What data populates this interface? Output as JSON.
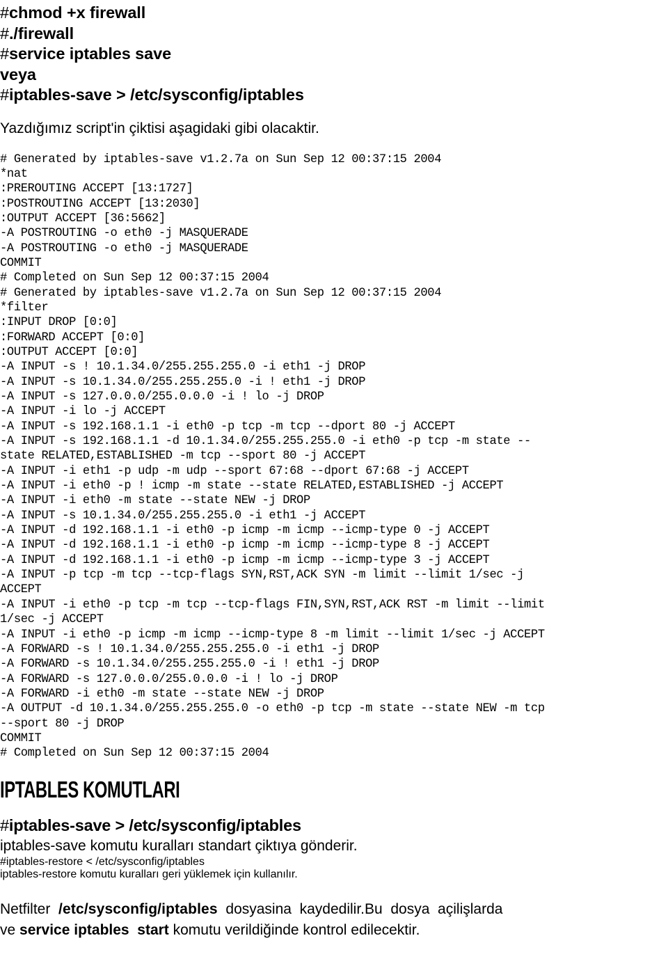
{
  "top_commands": [
    {
      "hash": "#",
      "text": "chmod +x firewall"
    },
    {
      "hash": "#",
      "text": "./firewall"
    },
    {
      "hash": "#",
      "text": "service iptables save"
    },
    {
      "hash": "",
      "text": "veya"
    },
    {
      "hash": "#",
      "text": "iptables-save > /etc/sysconfig/iptables"
    }
  ],
  "intro": "Yazdığımız script'in çiktisi aşagidaki gibi olacaktir.",
  "code_lines": [
    "# Generated by iptables-save v1.2.7a on Sun Sep 12 00:37:15 2004",
    "*nat",
    ":PREROUTING ACCEPT [13:1727]",
    ":POSTROUTING ACCEPT [13:2030]",
    ":OUTPUT ACCEPT [36:5662]",
    "-A POSTROUTING -o eth0 -j MASQUERADE",
    "-A POSTROUTING -o eth0 -j MASQUERADE",
    "COMMIT",
    "# Completed on Sun Sep 12 00:37:15 2004",
    "# Generated by iptables-save v1.2.7a on Sun Sep 12 00:37:15 2004",
    "*filter",
    ":INPUT DROP [0:0]",
    ":FORWARD ACCEPT [0:0]",
    ":OUTPUT ACCEPT [0:0]",
    "-A INPUT -s ! 10.1.34.0/255.255.255.0 -i eth1 -j DROP",
    "-A INPUT -s 10.1.34.0/255.255.255.0 -i ! eth1 -j DROP",
    "-A INPUT -s 127.0.0.0/255.0.0.0 -i ! lo -j DROP",
    "-A INPUT -i lo -j ACCEPT",
    "-A INPUT -s 192.168.1.1 -i eth0 -p tcp -m tcp --dport 80 -j ACCEPT",
    "-A INPUT -s 192.168.1.1 -d 10.1.34.0/255.255.255.0 -i eth0 -p tcp -m state --",
    "state RELATED,ESTABLISHED -m tcp --sport 80 -j ACCEPT",
    "-A INPUT -i eth1 -p udp -m udp --sport 67:68 --dport 67:68 -j ACCEPT",
    "-A INPUT -i eth0 -p ! icmp -m state --state RELATED,ESTABLISHED -j ACCEPT",
    "-A INPUT -i eth0 -m state --state NEW -j DROP",
    "-A INPUT -s 10.1.34.0/255.255.255.0 -i eth1 -j ACCEPT",
    "-A INPUT -d 192.168.1.1 -i eth0 -p icmp -m icmp --icmp-type 0 -j ACCEPT",
    "-A INPUT -d 192.168.1.1 -i eth0 -p icmp -m icmp --icmp-type 8 -j ACCEPT",
    "-A INPUT -d 192.168.1.1 -i eth0 -p icmp -m icmp --icmp-type 3 -j ACCEPT",
    "-A INPUT -p tcp -m tcp --tcp-flags SYN,RST,ACK SYN -m limit --limit 1/sec -j",
    "ACCEPT",
    "-A INPUT -i eth0 -p tcp -m tcp --tcp-flags FIN,SYN,RST,ACK RST -m limit --limit",
    "1/sec -j ACCEPT",
    "-A INPUT -i eth0 -p icmp -m icmp --icmp-type 8 -m limit --limit 1/sec -j ACCEPT",
    "-A FORWARD -s ! 10.1.34.0/255.255.255.0 -i eth1 -j DROP",
    "-A FORWARD -s 10.1.34.0/255.255.255.0 -i ! eth1 -j DROP",
    "-A FORWARD -s 127.0.0.0/255.0.0.0 -i ! lo -j DROP",
    "-A FORWARD -i eth0 -m state --state NEW -j DROP",
    "-A OUTPUT -d 10.1.34.0/255.255.255.0 -o eth0 -p tcp -m state --state NEW -m tcp",
    "--sport 80 -j DROP",
    "COMMIT",
    "# Completed on Sun Sep 12 00:37:15 2004"
  ],
  "section_heading": "IPTABLES KOMUTLARI",
  "lower_items": [
    {
      "hash": "#",
      "command": "iptables-save > /etc/sysconfig/iptables",
      "description": "iptables-save komutu kuralları standart çiktıya gönderir."
    },
    {
      "hash": "#",
      "command": "iptables-restore < /etc/sysconfig/iptables",
      "description": " iptables-restore komutu kuralları geri yüklemek için kullanılır."
    }
  ],
  "final_paragraph": {
    "line1_a": "Netfilter  ",
    "line1_b": "/etc/sysconfig/iptables",
    "line1_c": "  dosyasina  kaydedilir.Bu  dosya  açilişlarda",
    "line2_a": "ve ",
    "line2_b": "service iptables  start",
    "line2_c": " komutu verildiğinde kontrol edilecektir."
  }
}
